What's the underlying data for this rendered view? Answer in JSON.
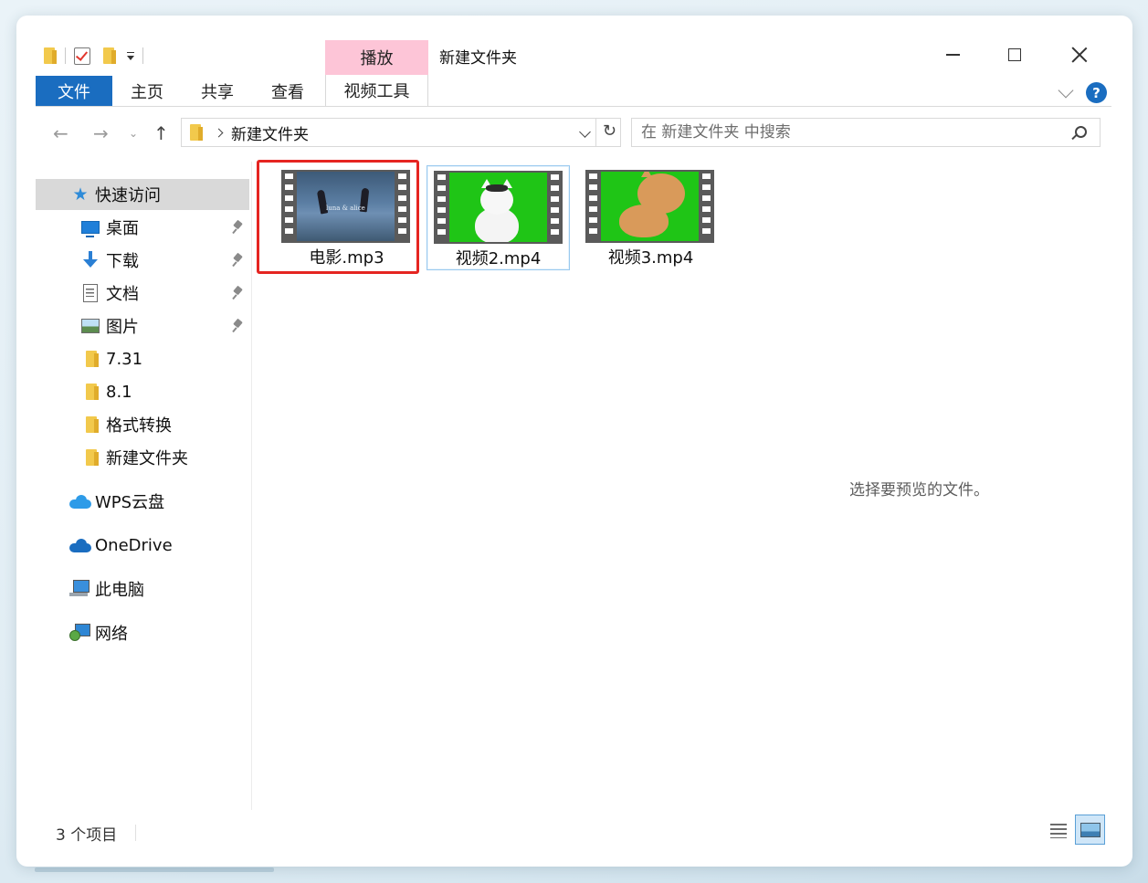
{
  "window": {
    "title": "新建文件夹",
    "contextual_tab_group": "播放",
    "contextual_tab": "视频工具"
  },
  "ribbon": {
    "file_tab": "文件",
    "tabs": [
      "主页",
      "共享",
      "查看"
    ],
    "help": "?"
  },
  "address": {
    "crumb": "新建文件夹",
    "search_placeholder": "在 新建文件夹 中搜索"
  },
  "sidebar": {
    "quick_access": "快速访问",
    "items": [
      {
        "label": "桌面",
        "icon": "desktop-icon",
        "pinned": true
      },
      {
        "label": "下载",
        "icon": "download-icon",
        "pinned": true
      },
      {
        "label": "文档",
        "icon": "document-icon",
        "pinned": true
      },
      {
        "label": "图片",
        "icon": "pictures-icon",
        "pinned": true
      },
      {
        "label": "7.31",
        "icon": "folder-icon",
        "pinned": false
      },
      {
        "label": "8.1",
        "icon": "folder-icon",
        "pinned": false
      },
      {
        "label": "格式转换",
        "icon": "folder-icon",
        "pinned": false
      },
      {
        "label": "新建文件夹",
        "icon": "folder-icon",
        "pinned": false
      }
    ],
    "wps": "WPS云盘",
    "onedrive": "OneDrive",
    "this_pc": "此电脑",
    "network": "网络"
  },
  "files": [
    {
      "name": "电影.mp3",
      "thumbnail_caption": "luna & alice",
      "highlighted": true
    },
    {
      "name": "视频2.mp4",
      "highlighted": false
    },
    {
      "name": "视频3.mp4",
      "highlighted": false
    }
  ],
  "preview_message": "选择要预览的文件。",
  "status": {
    "count": "3 个项目"
  },
  "colors": {
    "accent": "#1a6dc0",
    "contextual_tab": "#fdc5d7",
    "highlight": "#e52521",
    "green_screen": "#1fc516"
  }
}
